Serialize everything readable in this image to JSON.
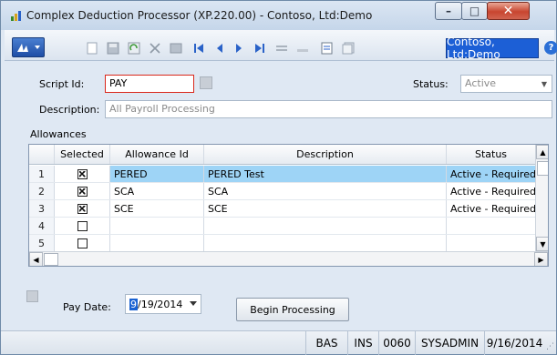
{
  "window": {
    "title": "Complex Deduction Processor (XP.220.00) - Contoso, Ltd:Demo",
    "minimize_glyph": "–",
    "maximize_glyph": "□",
    "close_glyph": "✕"
  },
  "toolbar": {
    "company_label": "Contoso, Ltd:Demo",
    "help_glyph": "?"
  },
  "form": {
    "script_id_label": "Script Id:",
    "script_id_value": "PAY",
    "status_label": "Status:",
    "status_value": "Active",
    "description_label": "Description:",
    "description_value": "All Payroll Processing",
    "allowances_label": "Allowances"
  },
  "grid": {
    "columns": [
      "Selected",
      "Allowance Id",
      "Description",
      "Status"
    ],
    "rows": [
      {
        "num": "1",
        "selected": true,
        "id": "PERED",
        "description": "PERED Test",
        "status": "Active - Required"
      },
      {
        "num": "2",
        "selected": true,
        "id": "SCA",
        "description": "SCA",
        "status": "Active - Required"
      },
      {
        "num": "3",
        "selected": true,
        "id": "SCE",
        "description": "SCE",
        "status": "Active - Required"
      },
      {
        "num": "4",
        "selected": false,
        "id": "",
        "description": "",
        "status": ""
      },
      {
        "num": "5",
        "selected": false,
        "id": "",
        "description": "",
        "status": ""
      }
    ]
  },
  "footer": {
    "pay_date_label": "Pay Date:",
    "pay_date_month": "9",
    "pay_date_rest": "/19/2014",
    "begin_button": "Begin Processing"
  },
  "statusbar": {
    "mode": "BAS",
    "ins": "INS",
    "cpny": "0060",
    "user": "SYSADMIN",
    "date": "9/16/2014"
  },
  "colors": {
    "accent": "#1c5fd6",
    "row_highlight": "#9ed4f6",
    "focus_border": "#d9271b"
  }
}
